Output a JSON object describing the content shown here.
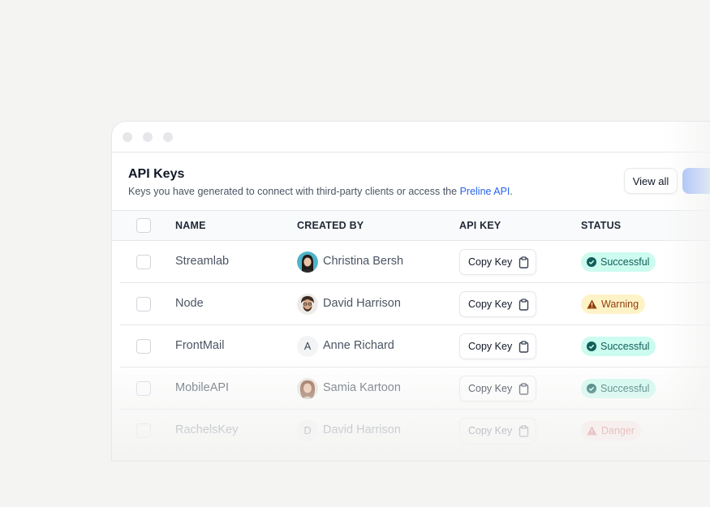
{
  "window": {
    "title": "API Keys",
    "subtitle_text": "Keys you have generated to connect with third-party clients or access the ",
    "subtitle_link": "Preline API",
    "subtitle_end": ".",
    "view_all_label": "View all"
  },
  "table": {
    "columns": [
      "NAME",
      "CREATED BY",
      "API KEY",
      "STATUS"
    ],
    "rows": [
      {
        "name": "Streamlab",
        "created_by": "Christina Bersh",
        "avatar": "photo",
        "key_label": "Copy Key",
        "status": "Successful",
        "status_type": "success"
      },
      {
        "name": "Node",
        "created_by": "David Harrison",
        "avatar": "photo",
        "key_label": "Copy Key",
        "status": "Warning",
        "status_type": "warning"
      },
      {
        "name": "FrontMail",
        "created_by": "Anne Richard",
        "avatar": "A",
        "key_label": "Copy Key",
        "status": "Successful",
        "status_type": "success"
      },
      {
        "name": "MobileAPI",
        "created_by": "Samia Kartoon",
        "avatar": "photo",
        "key_label": "Copy Key",
        "status": "Successful",
        "status_type": "success"
      },
      {
        "name": "RachelsKey",
        "created_by": "David Harrison",
        "avatar": "D",
        "key_label": "Copy Key",
        "status": "Danger",
        "status_type": "danger"
      }
    ]
  },
  "icons": {
    "copy": "clipboard-icon",
    "success": "check-circle-icon",
    "warning": "warning-triangle-icon",
    "danger": "warning-triangle-icon"
  },
  "colors": {
    "link": "#2563eb",
    "success_bg": "#ccfbef",
    "warning_bg": "#fef3c7",
    "danger_bg": "#fee2e2"
  }
}
